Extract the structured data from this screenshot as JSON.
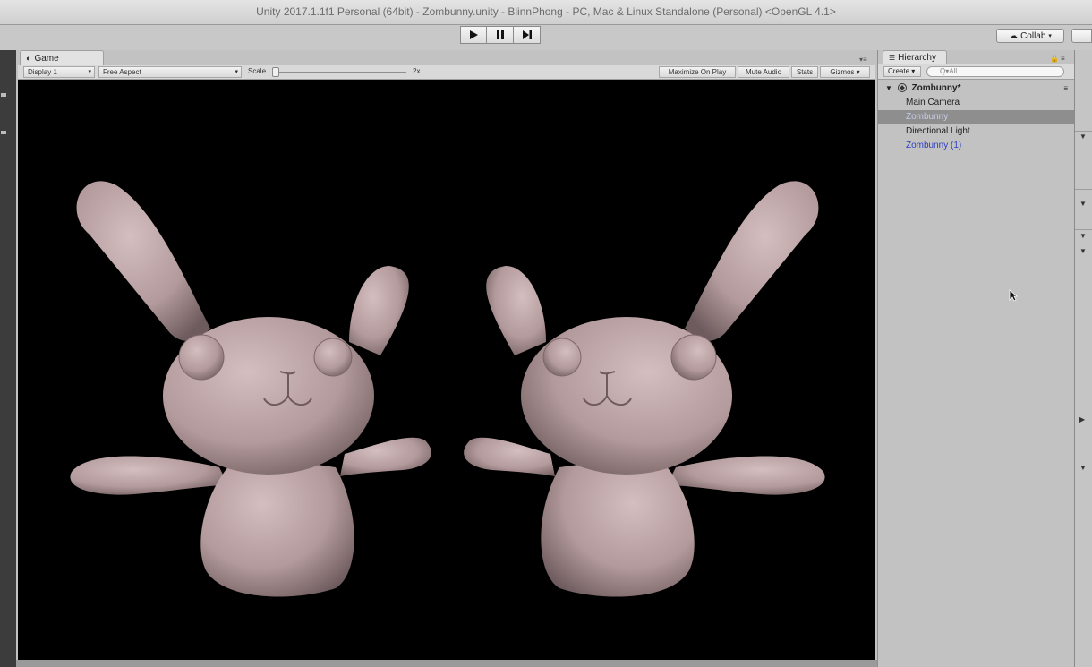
{
  "window": {
    "title": "Unity 2017.1.1f1 Personal (64bit) - Zombunny.unity - BlinnPhong - PC, Mac & Linux Standalone (Personal) <OpenGL 4.1>"
  },
  "toolbar": {
    "play_icon": "play-icon",
    "pause_icon": "pause-icon",
    "step_icon": "step-icon",
    "collab_label": "Collab"
  },
  "game": {
    "tab_label": "Game",
    "display_label": "Display 1",
    "aspect_label": "Free Aspect",
    "scale_label": "Scale",
    "scale_value": "2x",
    "scale_level": 0.02,
    "maximize_label": "Maximize On Play",
    "mute_label": "Mute Audio",
    "stats_label": "Stats",
    "gizmos_label": "Gizmos"
  },
  "hierarchy": {
    "tab_label": "Hierarchy",
    "create_label": "Create",
    "search_placeholder": "Q▾All",
    "scene_name": "Zombunny*",
    "items": [
      {
        "label": "Main Camera",
        "selected": false,
        "prefab": false
      },
      {
        "label": "Zombunny",
        "selected": true,
        "prefab": true
      },
      {
        "label": "Directional Light",
        "selected": false,
        "prefab": false
      },
      {
        "label": "Zombunny (1)",
        "selected": false,
        "prefab": true
      }
    ]
  },
  "colors": {
    "bunny": "#b39a9c",
    "viewport_bg": "#000000",
    "selection": "#8e8e8e",
    "prefab_text": "#2d3fbf"
  }
}
